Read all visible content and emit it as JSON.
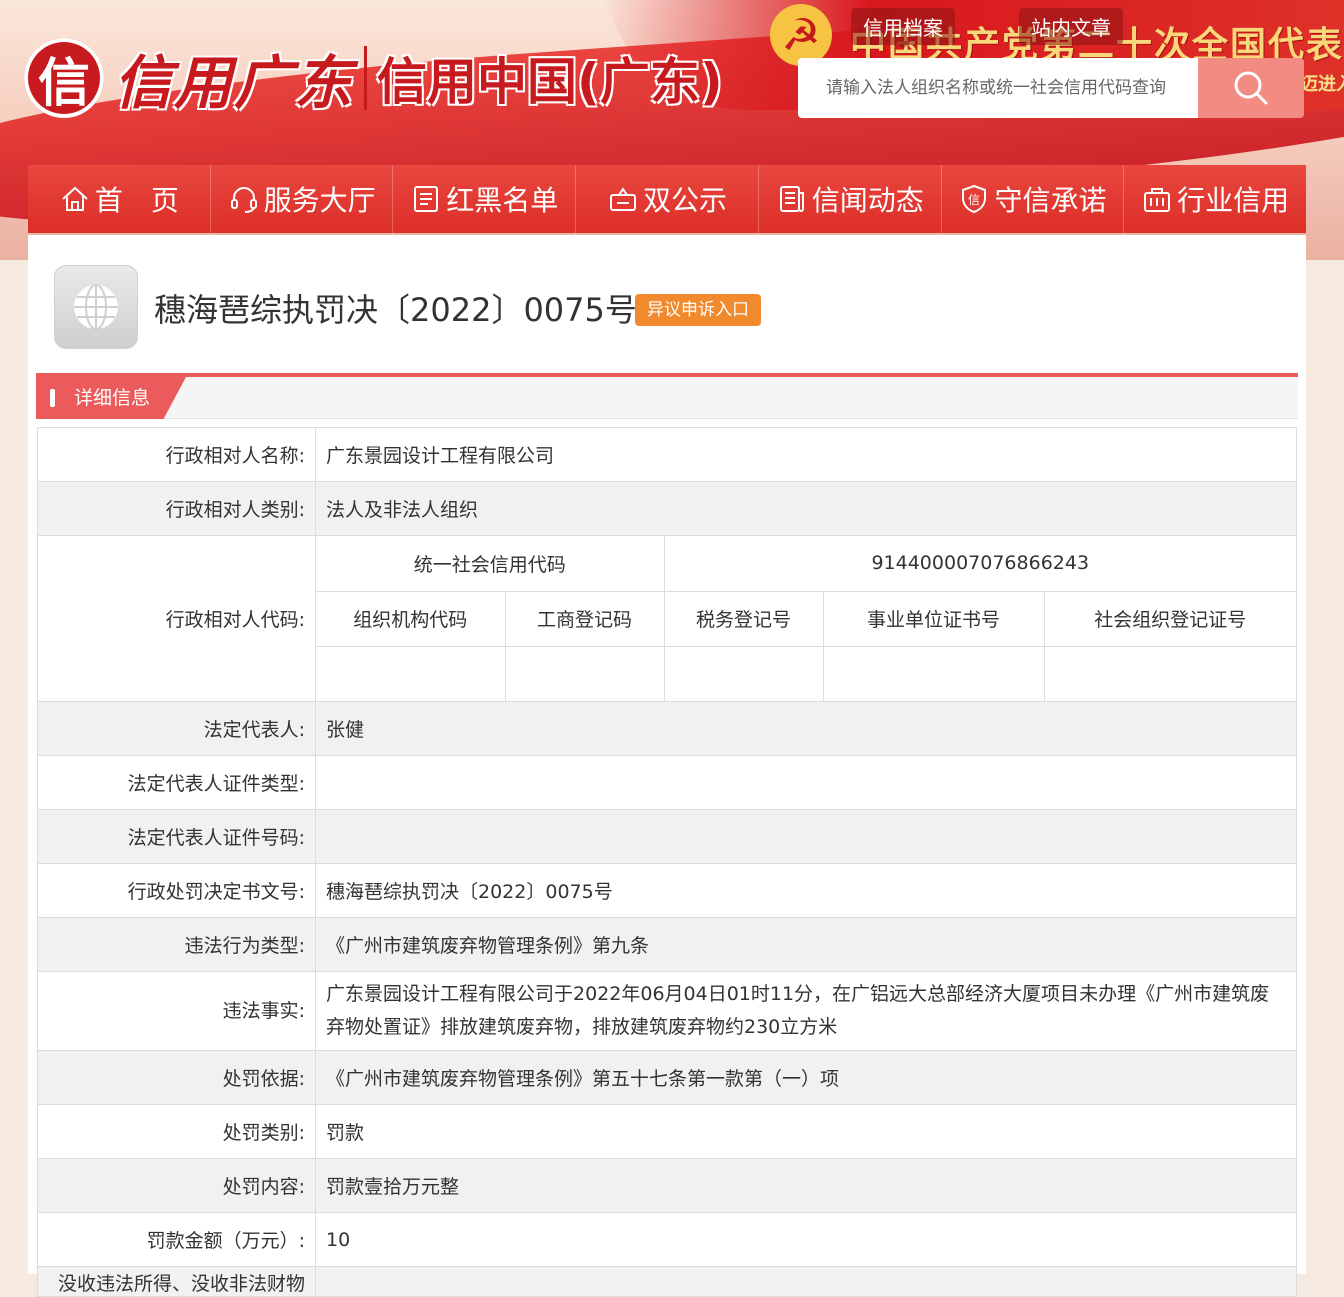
{
  "header": {
    "logo_mark": "信",
    "logo_text1": "信用广东",
    "logo_text2": "信用中国(广东)",
    "banner_slogan": "中国共产党第二十次全国代表大",
    "banner_slogan_sub": "迈进入",
    "search_tabs": [
      "信用档案",
      "站内文章"
    ],
    "search_placeholder": "请输入法人组织名称或统一社会信用代码查询"
  },
  "nav": {
    "items": [
      "首　页",
      "服务大厅",
      "红黑名单",
      "双公示",
      "信闻动态",
      "守信承诺",
      "行业信用"
    ]
  },
  "document": {
    "title": "穗海琶综执罚决〔2022〕0075号",
    "appeal_button": "异议申诉入口",
    "section_title": "详细信息"
  },
  "details": {
    "name_label": "行政相对人名称:",
    "name_value": "广东景园设计工程有限公司",
    "category_label": "行政相对人类别:",
    "category_value": "法人及非法人组织",
    "code_label": "行政相对人代码:",
    "codes": {
      "uscc_label": "统一社会信用代码",
      "uscc_value": "91440000707686624З",
      "org_code_label": "组织机构代码",
      "business_reg_label": "工商登记码",
      "tax_reg_label": "税务登记号",
      "institution_cert_label": "事业单位证书号",
      "social_org_label": "社会组织登记证号",
      "org_code_value": "",
      "business_reg_value": "",
      "tax_reg_value": "",
      "institution_cert_value": "",
      "social_org_value": ""
    },
    "legal_rep_label": "法定代表人:",
    "legal_rep_value": "张健",
    "legal_rep_id_type_label": "法定代表人证件类型:",
    "legal_rep_id_type_value": "",
    "legal_rep_id_no_label": "法定代表人证件号码:",
    "legal_rep_id_no_value": "",
    "decision_no_label": "行政处罚决定书文号:",
    "decision_no_value": "穗海琶综执罚决〔2022〕0075号",
    "violation_type_label": "违法行为类型:",
    "violation_type_value": "《广州市建筑废弃物管理条例》第九条",
    "violation_facts_label": "违法事实:",
    "violation_facts_value": "广东景园设计工程有限公司于2022年06月04日01时11分，在广铝远大总部经济大厦项目未办理《广州市建筑废弃物处置证》排放建筑废弃物，排放建筑废弃物约230立方米",
    "basis_label": "处罚依据:",
    "basis_value": "《广州市建筑废弃物管理条例》第五十七条第一款第（一）项",
    "penalty_type_label": "处罚类别:",
    "penalty_type_value": "罚款",
    "penalty_content_label": "处罚内容:",
    "penalty_content_value": "罚款壹拾万元整",
    "fine_amount_label": "罚款金额（万元）:",
    "fine_amount_value": "10",
    "next_label": "没收违法所得、没收非法财物"
  },
  "colors": {
    "nav_red": "#db2e27",
    "section_red": "#ec5b5b",
    "appeal_orange": "#f08a2c"
  }
}
